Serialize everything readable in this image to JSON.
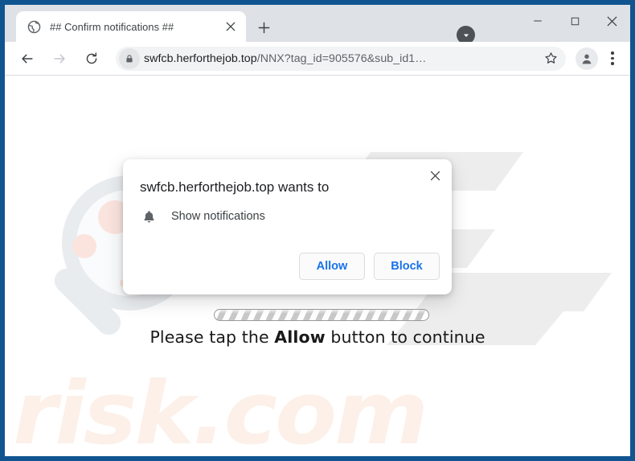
{
  "window": {
    "frame_color": "#10558f",
    "controls": {
      "caret_icon": "caret-down-circle-icon",
      "minimize_label": "—",
      "maximize_label": "□",
      "close_label": "✕"
    }
  },
  "tabstrip": {
    "tab": {
      "favicon": "globe-favicon-icon",
      "title": "## Confirm notifications ##",
      "close_label": "✕"
    },
    "new_tab_label": "+"
  },
  "toolbar": {
    "back_icon": "back-arrow-icon",
    "forward_icon": "forward-arrow-icon",
    "reload_icon": "reload-icon",
    "lock_icon": "padlock-icon",
    "url_host": "swfcb.herforthejob.top",
    "url_path": "/NNX?tag_id=905576&sub_id1…",
    "url_full": "swfcb.herforthejob.top/NNX?tag_id=905576&sub_id1…",
    "bookmark_icon": "star-icon",
    "profile_icon": "profile-avatar-icon",
    "menu_icon": "three-dot-menu-icon"
  },
  "dialog": {
    "title": "swfcb.herforthejob.top wants to",
    "permission_icon": "bell-icon",
    "permission_label": "Show notifications",
    "allow_label": "Allow",
    "block_label": "Block",
    "close_label": "✕",
    "button_text_color": "#1a73e8"
  },
  "page": {
    "prompt_prefix": "Please tap the ",
    "prompt_emphasis": "Allow",
    "prompt_suffix": " button to continue",
    "progress_style": "striped-indeterminate",
    "watermark_text": "risk.com",
    "watermark_color": "#fcf0e8",
    "watermark_graphic": "magnifier-watermark-icon",
    "watermark_letters": "pc-watermark-icon"
  }
}
